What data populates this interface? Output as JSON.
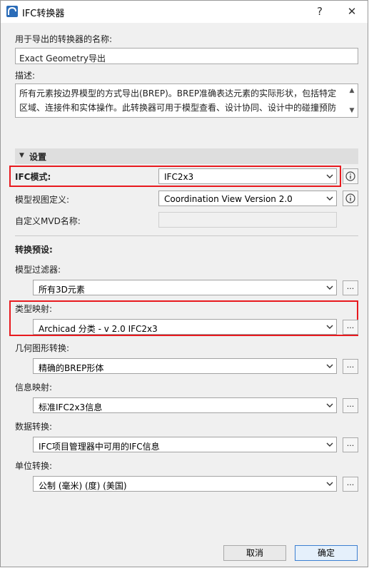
{
  "window": {
    "title": "IFC转换器",
    "help": "?",
    "close": "✕"
  },
  "name_section": {
    "label": "用于导出的转换器的名称:",
    "value": "Exact Geometry导出"
  },
  "description": {
    "label": "描述:",
    "text": "所有元素按边界模型的方式导出(BREP)。BREP准确表达元素的实际形状，包括特定区域、连接件和实体操作。此转换器可用于模型查看、设计协同、设计中的碰撞预防以及碰撞检查。"
  },
  "settings": {
    "header": "设置",
    "ifc_mode": {
      "label": "IFC模式:",
      "value": "IFC2x3"
    },
    "mvd": {
      "label": "模型视图定义:",
      "value": "Coordination View Version 2.0"
    },
    "custom_mvd": {
      "label": "自定义MVD名称:",
      "value": ""
    }
  },
  "presets": {
    "header": "转换预设:",
    "items": [
      {
        "label": "模型过滤器:",
        "value": "所有3D元素"
      },
      {
        "label": "类型映射:",
        "value": "Archicad 分类 - v 2.0 IFC2x3"
      },
      {
        "label": "几何图形转换:",
        "value": "精确的BREP形体"
      },
      {
        "label": "信息映射:",
        "value": "标准IFC2x3信息"
      },
      {
        "label": "数据转换:",
        "value": "IFC项目管理器中可用的IFC信息"
      },
      {
        "label": "单位转换:",
        "value": "公制 (毫米) (度) (美国)"
      }
    ],
    "more": "..."
  },
  "buttons": {
    "cancel": "取消",
    "ok": "确定"
  },
  "colors": {
    "highlight": "#e8191e",
    "ok_border": "#3c7fd1"
  }
}
